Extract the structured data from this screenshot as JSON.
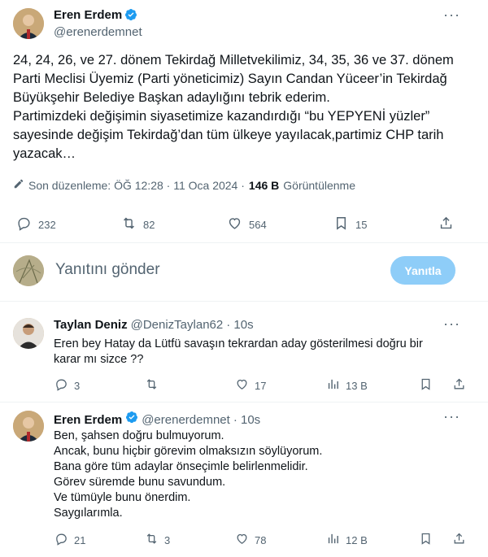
{
  "main_tweet": {
    "author_name": "Eren Erdem",
    "author_handle": "@erenerdemnet",
    "more_label": "···",
    "text": "24, 24, 26, ve 27. dönem Tekirdağ Milletvekilimiz, 34, 35, 36 ve 37. dönem\nParti Meclisi Üyemiz (Parti yöneticimiz) Sayın Candan Yüceer’in Tekirdağ\nBüyükşehir Belediye Başkan adaylığını tebrik ederim.\nPartimizdeki değişimin siyasetimize kazandırdığı “bu YEPYENİ yüzler”\nsayesinde değişim Tekirdağ’dan tüm ülkeye yayılacak,partimiz CHP tarih\nyazacak…",
    "edited_label": "Son düzenleme: ÖĞ 12:28 · 11 Oca 2024 ·",
    "views_count": "146 B",
    "views_label": "Görüntülenme",
    "stats": {
      "replies": "232",
      "retweets": "82",
      "likes": "564",
      "bookmarks": "15"
    }
  },
  "compose": {
    "placeholder": "Yanıtını gönder",
    "button_label": "Yanıtla"
  },
  "replies": [
    {
      "author_name": "Taylan Deniz",
      "author_handle": "@DenizTaylan62",
      "time": "· 10s",
      "text": "Eren bey Hatay da Lütfü savaşın tekrardan aday gösterilmesi doğru bir\nkarar mı sizce ??",
      "replies": "3",
      "retweets": "",
      "likes": "17",
      "views": "13 B"
    },
    {
      "author_name": "Eren Erdem",
      "author_handle": "@erenerdemnet",
      "time": "· 10s",
      "text": "Ben, şahsen doğru bulmuyorum.\nAncak, bunu hiçbir görevim olmaksızın söylüyorum.\nBana göre tüm adaylar önseçimle belirlenmelidir.\nGörev süremde bunu savundum.\nVe tümüyle bunu önerdim.\nSaygılarımla.",
      "replies": "21",
      "retweets": "3",
      "likes": "78",
      "views": "12 B"
    }
  ],
  "colors": {
    "verified": "#1d9bf0",
    "reply_button": "#8ecdf8",
    "muted": "#536471"
  }
}
